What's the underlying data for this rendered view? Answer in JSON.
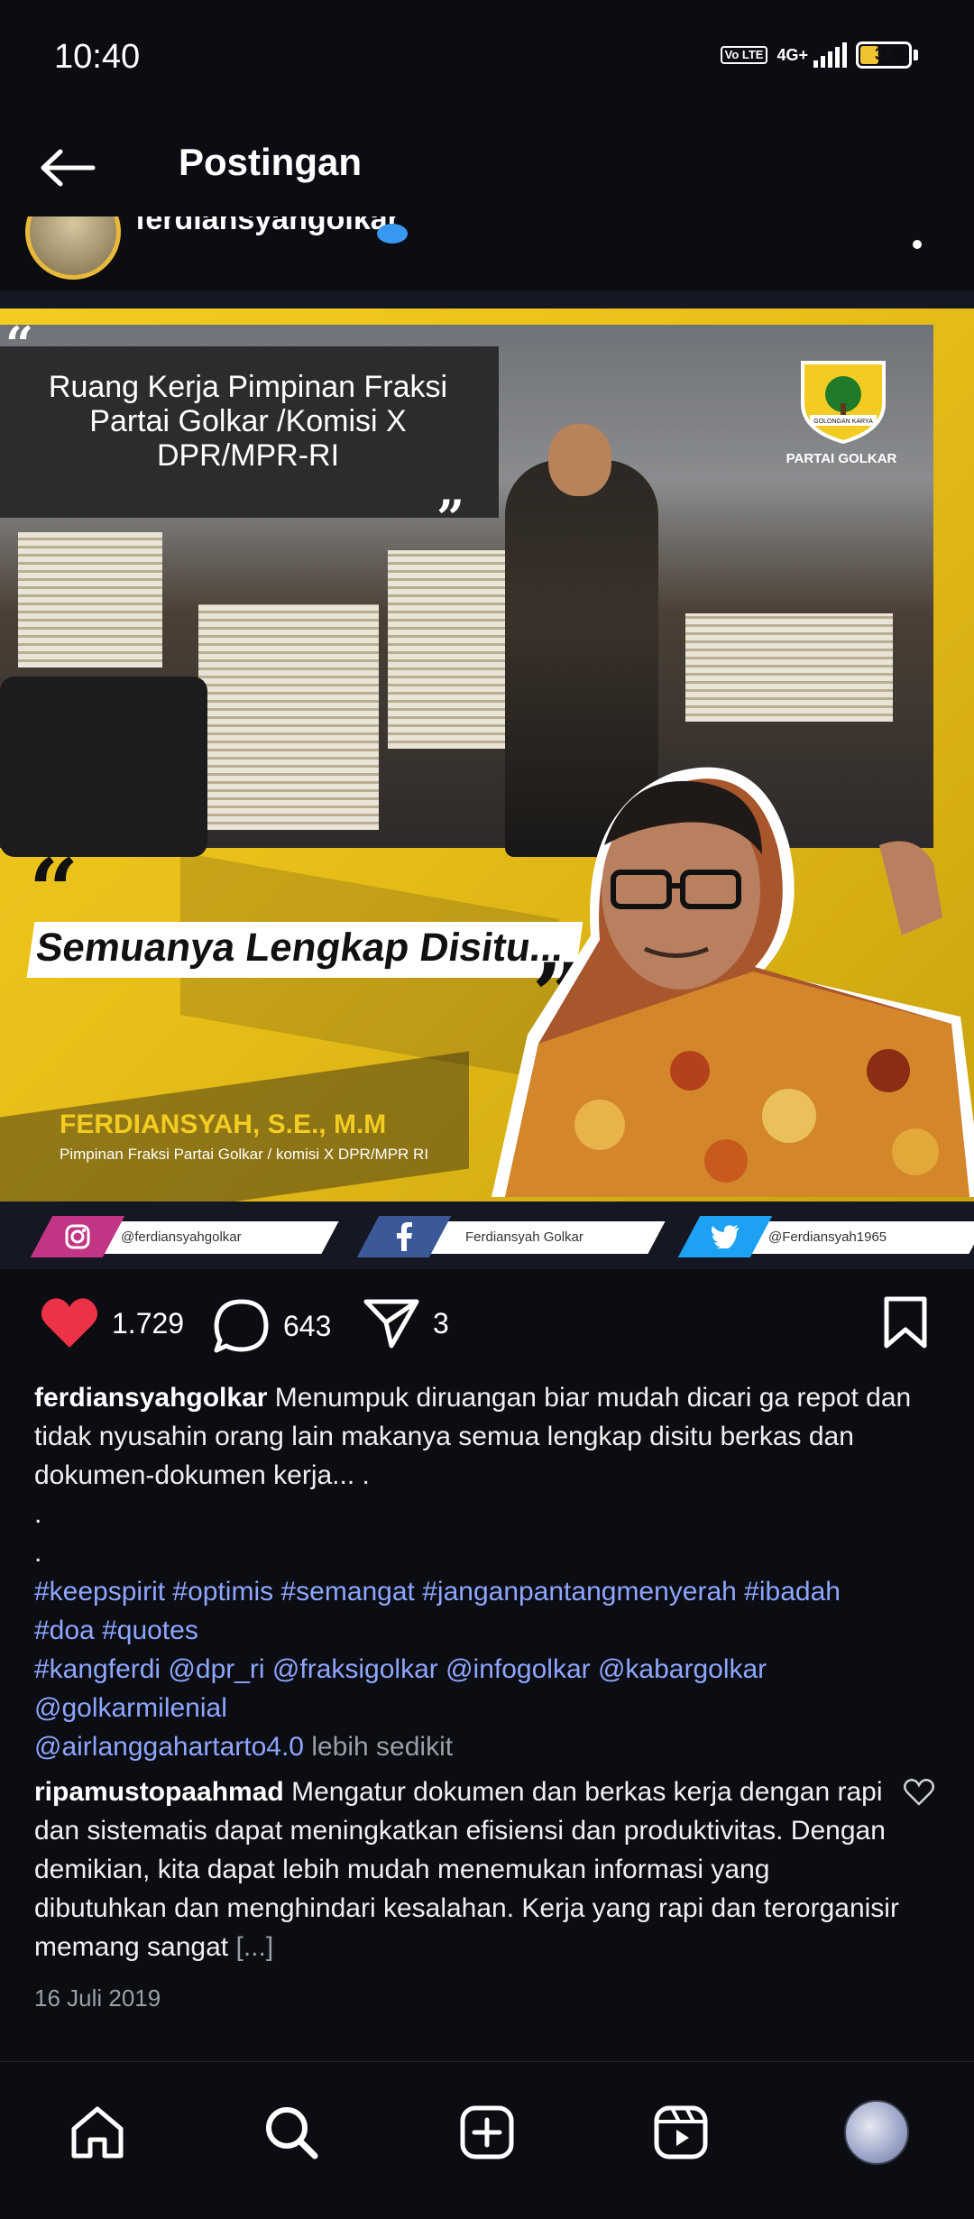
{
  "status": {
    "time": "10:40",
    "volte": "Vo LTE",
    "network": "4G+",
    "battery": "39",
    "battery_level": 0.39
  },
  "header": {
    "title": "Postingan",
    "back_icon": "arrow-left-icon"
  },
  "author": {
    "username": "ferdiansyahgolkar"
  },
  "image": {
    "quote_text": "Ruang Kerja Pimpinan Fraksi Partai Golkar /Komisi X DPR/MPR-RI",
    "logo_top": "GOLONGAN KARYA",
    "logo_label": "PARTAI GOLKAR",
    "headline": "Semuanya Lengkap Disitu...",
    "name": "FERDIANSYAH, S.E., M.M",
    "name_sub": "Pimpinan Fraksi Partai Golkar / komisi X DPR/MPR RI",
    "socials": [
      {
        "icon": "instagram-icon",
        "label": "@ferdiansyahgolkar",
        "color": "#c13584"
      },
      {
        "icon": "facebook-icon",
        "label": "Ferdiansyah Golkar",
        "color": "#3b5998"
      },
      {
        "icon": "twitter-icon",
        "label": "@Ferdiansyah1965",
        "color": "#1da1f2"
      }
    ]
  },
  "actions": {
    "likes": "1.729",
    "comments": "643",
    "shares": "3"
  },
  "caption": {
    "username": "ferdiansyahgolkar",
    "text": "Menumpuk diruangan biar mudah dicari ga repot dan tidak nyusahin orang lain makanya semua lengkap disitu berkas dan dokumen-dokumen kerja... .",
    "dot1": ".",
    "dot2": ".",
    "hashtags_line1": "#keepspirit #optimis #semangat #janganpantangmenyerah #ibadah",
    "hashtags_line2": "#doa #quotes",
    "mentions_line1": "#kangferdi @dpr_ri @fraksigolkar @infogolkar @kabargolkar",
    "mentions_line2": "@golkarmilenial",
    "mentions_line3": "@airlanggahartarto4.0",
    "less": "lebih sedikit"
  },
  "comment": {
    "username": "ripamustopaahmad",
    "text": "Mengatur dokumen dan berkas kerja dengan rapi dan sistematis dapat meningkatkan efisiensi dan produktivitas. Dengan demikian, kita dapat lebih mudah menemukan informasi yang dibutuhkan dan menghindari kesalahan. Kerja yang rapi dan terorganisir memang sangat",
    "more": "[...]"
  },
  "date": "16 Juli 2019",
  "nav": {
    "items": [
      "home-icon",
      "search-icon",
      "create-icon",
      "reels-icon",
      "profile-avatar"
    ]
  },
  "colors": {
    "like": "#ed3146",
    "accent_yellow": "#f2cc22",
    "link": "#8ea6ff"
  }
}
